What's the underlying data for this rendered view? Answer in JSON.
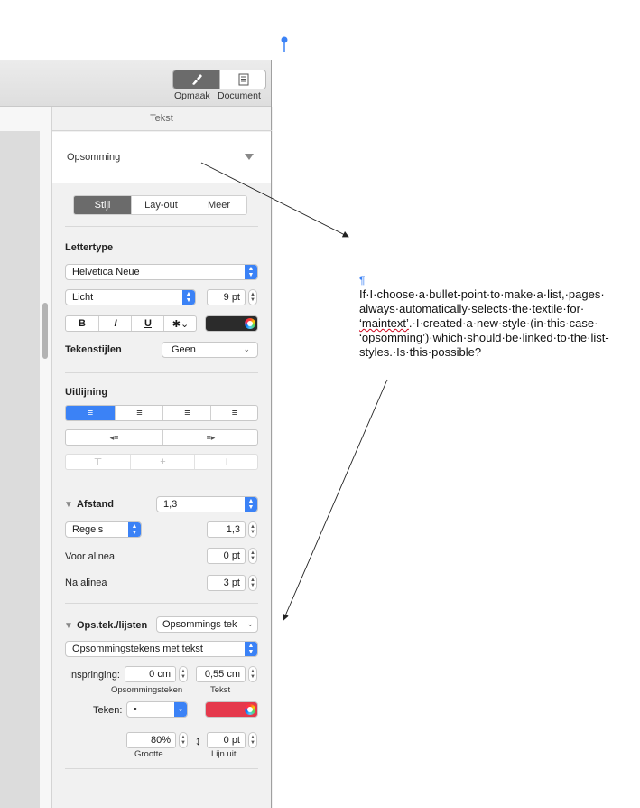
{
  "toolbar": {
    "format_label": "Opmaak",
    "document_label": "Document",
    "format_icon": "paintbrush-icon",
    "document_icon": "document-icon"
  },
  "panel": {
    "header": "Tekst",
    "paragraph_style": "Opsomming",
    "tabs": [
      "Stijl",
      "Lay-out",
      "Meer"
    ],
    "font": {
      "heading": "Lettertype",
      "family": "Helvetica Neue",
      "typeface": "Licht",
      "size": "9 pt",
      "bold": "B",
      "italic": "I",
      "underline": "U",
      "char_styles_label": "Tekenstijlen",
      "char_styles_value": "Geen"
    },
    "alignment": {
      "heading": "Uitlijning"
    },
    "spacing": {
      "heading": "Afstand",
      "value": "1,3",
      "mode": "Regels",
      "mode_value": "1,3",
      "before_label": "Voor alinea",
      "before_value": "0 pt",
      "after_label": "Na alinea",
      "after_value": "3 pt"
    },
    "bullets": {
      "heading": "Ops.tek./lijsten",
      "list_style": "Opsommings tek",
      "type": "Opsommingstekens met tekst",
      "indent_label": "Inspringing:",
      "bullet_indent": "0 cm",
      "text_indent": "0,55 cm",
      "bullet_indent_caption": "Opsommingsteken",
      "text_indent_caption": "Tekst",
      "bullet_label": "Teken:",
      "bullet_char": "•",
      "bullet_color": "#e5394c",
      "size_value": "80%",
      "size_caption": "Grootte",
      "align_value": "0 pt",
      "align_caption": "Lijn uit"
    }
  },
  "note": {
    "pilcrow": "¶",
    "line1": "If·I·choose·a·bullet-point·to·make·a·list,·pages·",
    "line2": "always·automatically·selects·the·textile·for·",
    "line3a": "‘maintext’",
    "line3b": ".·I·created·a·new·style·(in·this·case·",
    "line4": "‘opsomming’)·which·should·be·linked·to·the·list-",
    "line5": "styles.·Is·this·possible?"
  },
  "colors": {
    "accent": "#3b82f6",
    "selected_tab": "#6b6b6b"
  }
}
